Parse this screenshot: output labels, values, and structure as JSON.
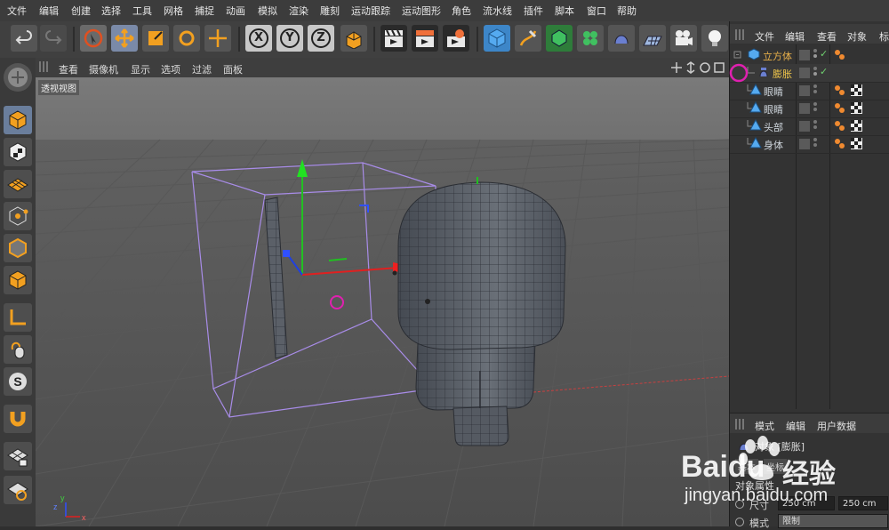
{
  "menubar": {
    "items": [
      "文件",
      "编辑",
      "创建",
      "选择",
      "工具",
      "网格",
      "捕捉",
      "动画",
      "模拟",
      "渲染",
      "雕刻",
      "运动跟踪",
      "运动图形",
      "角色",
      "流水线",
      "插件",
      "脚本",
      "窗口",
      "帮助"
    ]
  },
  "toolbar": {
    "axis_x": "X",
    "axis_y": "Y",
    "axis_z": "Z",
    "icons": [
      "undo-icon",
      "redo-icon",
      "live-select-icon",
      "move-icon",
      "scale-icon",
      "rotate-icon",
      "world-move-icon",
      "coordinate-system-icon",
      "render-view-icon",
      "render-picture-queue-icon",
      "render-settings-icon",
      "cube-object-icon",
      "pen-spline-icon",
      "subdivision-surface-icon",
      "cloner-icon",
      "deformer-icon",
      "floor-icon",
      "camera-icon",
      "light-icon"
    ]
  },
  "viewport": {
    "menu": [
      "查看",
      "摄像机",
      "显示",
      "选项",
      "过滤",
      "面板"
    ],
    "label": "透视视图"
  },
  "object_manager": {
    "menu": [
      "文件",
      "编辑",
      "查看",
      "对象",
      "标"
    ],
    "objects": [
      {
        "name": "立方体",
        "color": "#e8b04a",
        "indent": 0
      },
      {
        "name": "膨胀",
        "color": "#f2c84b",
        "indent": 1
      },
      {
        "name": "眼睛",
        "color": "#cfd6dd",
        "indent": 1
      },
      {
        "name": "眼睛",
        "color": "#cfd6dd",
        "indent": 1
      },
      {
        "name": "头部",
        "color": "#cfd6dd",
        "indent": 1
      },
      {
        "name": "身体",
        "color": "#cfd6dd",
        "indent": 1
      }
    ]
  },
  "attributes": {
    "menu": [
      "模式",
      "编辑",
      "用户数据"
    ],
    "object_title": "对象 [膨胀]",
    "tab_label": "基本",
    "tab_label2": "坐标",
    "section": "对象属性",
    "size_label": "尺寸",
    "size_x": "250 cm",
    "size_y": "250 cm",
    "mode_label": "模式",
    "mode_value": "限制"
  },
  "watermark": {
    "brand": "Baidu",
    "brand2": "经验",
    "url": "jingyan.baidu.com"
  },
  "colors": {
    "accent": "#f2c84b",
    "selection": "#c060ff",
    "magenta": "#e020b0"
  }
}
